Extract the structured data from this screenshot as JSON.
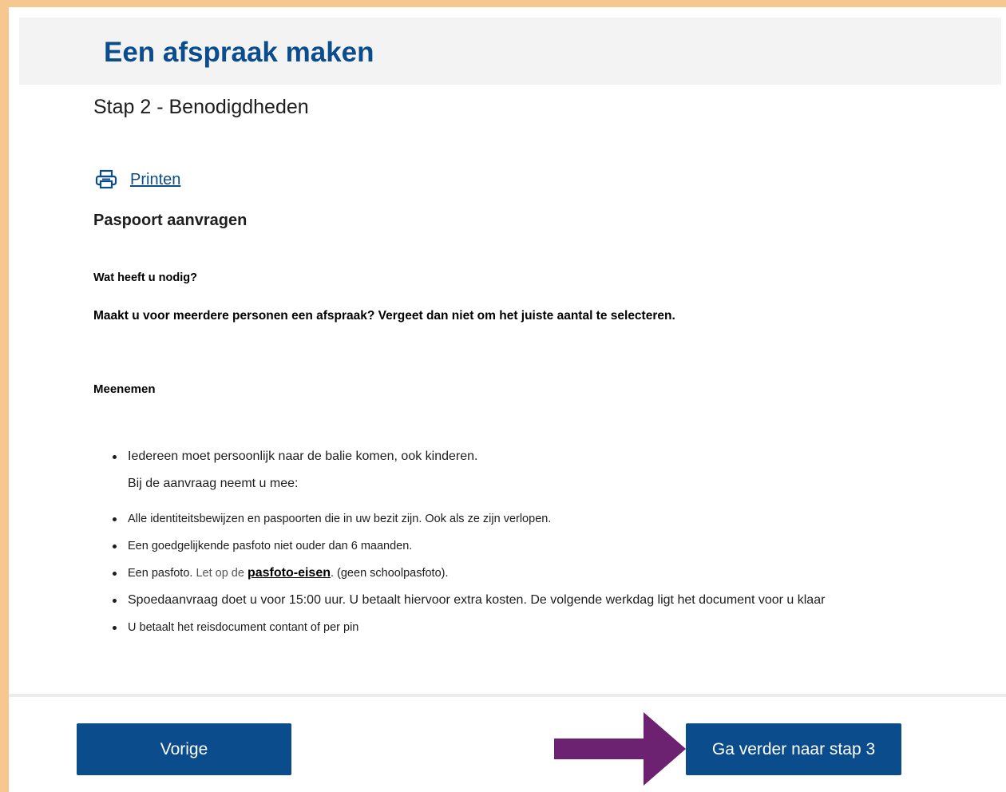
{
  "header": {
    "title": "Een afspraak maken"
  },
  "step": {
    "title": "Stap 2 - Benodigdheden"
  },
  "print": {
    "icon": "printer-icon",
    "label": "Printen"
  },
  "section": {
    "title": "Paspoort aanvragen",
    "question": "Wat heeft u nodig?",
    "notice": "Maakt u voor meerdere personen een afspraak? Vergeet dan niet om het juiste aantal te selecteren.",
    "bring_heading": "Meenemen"
  },
  "items": {
    "i1": "Iedereen moet persoonlijk naar de balie komen, ook kinderen.",
    "i1_sub": "Bij de aanvraag neemt u mee:",
    "i2": "Alle identiteitsbewijzen en paspoorten die in uw bezit zijn. Ook als ze zijn verlopen.",
    "i3": "Een goedgelijkende pasfoto niet ouder dan 6 maanden.",
    "i4_pre": "Een pasfoto.",
    "i4_letop": "Let op de",
    "i4_link": "pasfoto-eisen",
    "i4_post": ". (geen schoolpasfoto).",
    "i5": "Spoedaanvraag doet u voor 15:00 uur. U betaalt hiervoor extra kosten. De volgende werkdag ligt het document voor u klaar",
    "i6": "U betaalt het reisdocument contant of per pin"
  },
  "footer": {
    "prev_label": "Vorige",
    "next_label": "Ga verder naar stap 3"
  },
  "colors": {
    "brand_blue": "#0b4d8c",
    "frame_border": "#f6c890",
    "arrow": "#6c2270"
  }
}
